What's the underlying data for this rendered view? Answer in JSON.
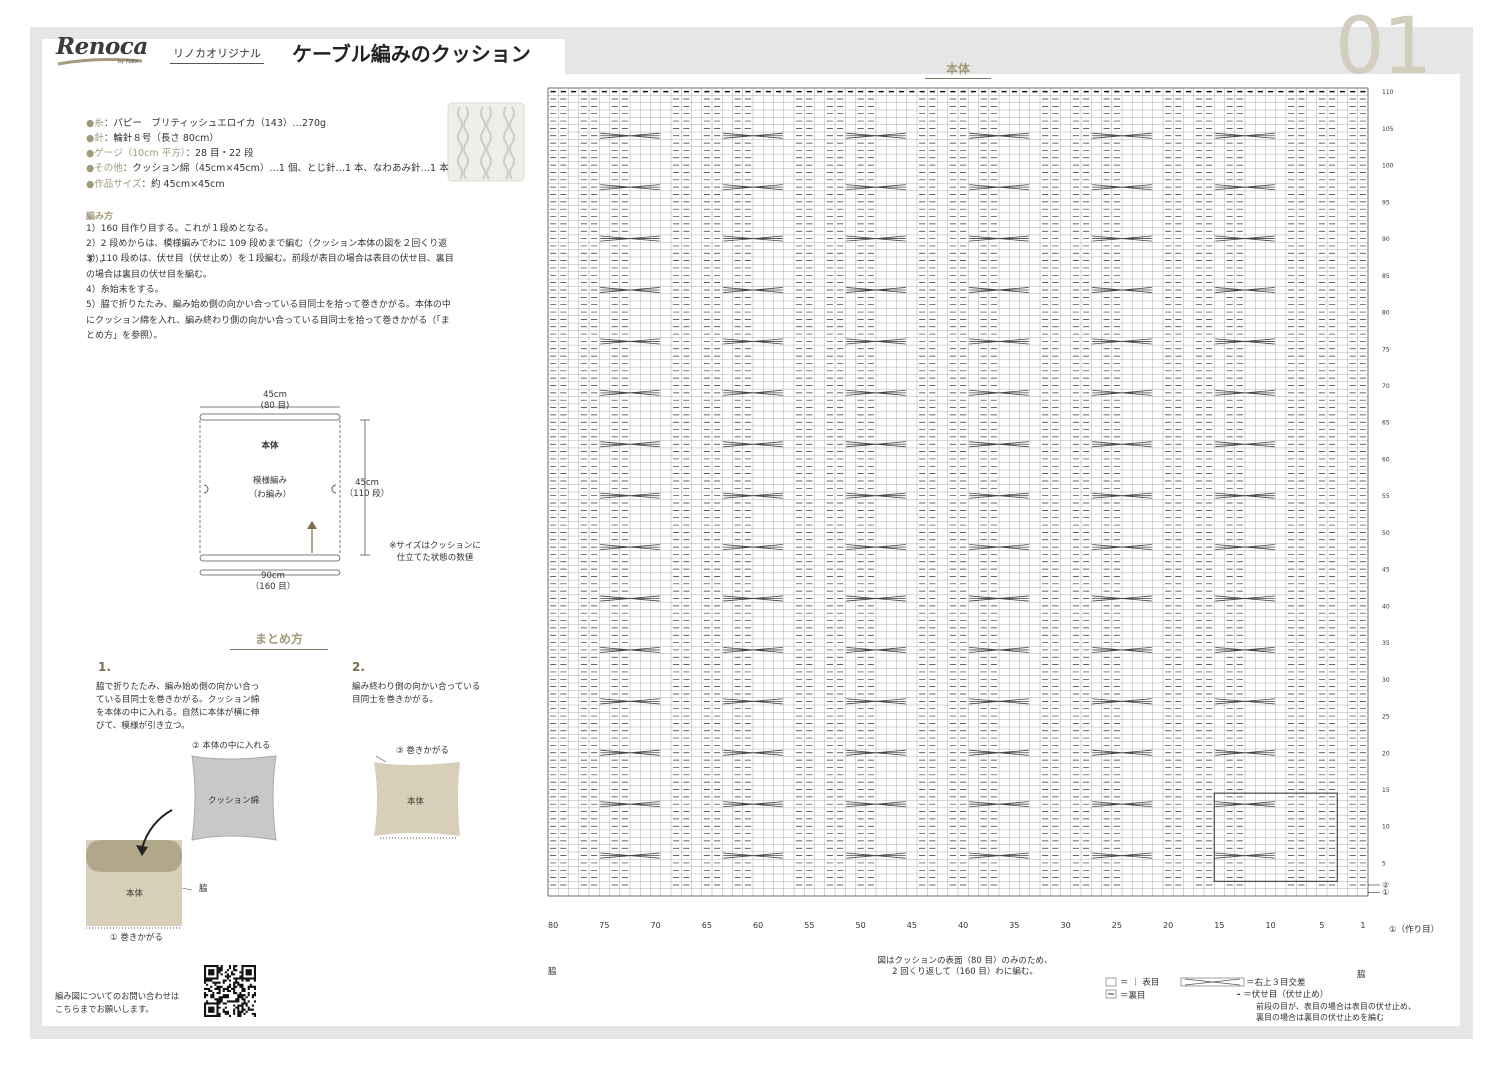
{
  "header": {
    "logo": "Renoca",
    "logo_sub": "by FLEX",
    "subtitle": "リノカオリジナル",
    "title": "ケーブル編みのクッション",
    "page_number": "01"
  },
  "materials": [
    {
      "label": "糸",
      "text": "：パピー　ブリティッシュエロイカ（143）…270g"
    },
    {
      "label": "針",
      "text": "：輪針８号（長さ 80cm）"
    },
    {
      "label": "ゲージ（10cm 平方）",
      "text": "：28 目・22 段"
    },
    {
      "label": "その他",
      "text": "：クッション綿（45cm×45cm）…1 個、とじ針…1 本、なわあみ針…1 本"
    },
    {
      "label": "作品サイズ",
      "text": "：約 45cm×45cm"
    }
  ],
  "instructions": {
    "heading": "編み方",
    "steps": [
      "1）160 目作り目する。これが１段めとなる。",
      "2）2 段めからは、模様編みでわに 109 段めまで編む（クッション本体の図を２回くり返す）。",
      "3）110 段めは、伏せ目（伏せ止め）を１段編む。前段が表目の場合は表目の伏せ目、裏目の場合は裏目の伏せ目を編む。",
      "4）糸始末をする。",
      "5）脇で折りたたみ、編み始め側の向かい合っている目同士を拾って巻きかがる。本体の中にクッション綿を入れ、編み終わり側の向かい合っている目同士を拾って巻きかがる（「まとめ方」を参照）。"
    ]
  },
  "schematic": {
    "width_top": "45cm",
    "width_top_sts": "(80 目)",
    "body_label": "本体",
    "pattern_label": "模様編み",
    "pattern_sub": "（わ編み）",
    "height": "45cm",
    "height_rows": "（110 段）",
    "width_bottom": "90cm",
    "width_bottom_sts": "（160 目）",
    "note_line1": "※サイズはクッションに",
    "note_line2": "仕立てた状態の数値"
  },
  "finishing": {
    "title": "まとめ方",
    "step1_num": "1.",
    "step1_text": [
      "脇で折りたたみ、編み始め側の向かい合っ",
      "ている目同士を巻きかがる。クッション綿",
      "を本体の中に入れる。自然に本体が横に伸",
      "びて、模様が引き立つ。"
    ],
    "step1_fill_label": "② 本体の中に入れる",
    "step1_cushion_label": "クッション綿",
    "step1_body_label": "本体",
    "step1_side_label": "脇",
    "step1_whip_label": "① 巻きかがる",
    "step2_num": "2.",
    "step2_text": [
      "編み終わり側の向かい合っている",
      "目同士を巻きかがる。"
    ],
    "step2_whip_label": "③ 巻きかがる",
    "step2_body_label": "本体"
  },
  "contact": {
    "line1": "編み図についてのお問い合わせは",
    "line2": "こちらまでお願いします。"
  },
  "chart": {
    "title": "本体",
    "stitches": 80,
    "rows": 110,
    "column_labels": [
      "80",
      "75",
      "70",
      "65",
      "60",
      "55",
      "50",
      "45",
      "40",
      "35",
      "30",
      "25",
      "20",
      "15",
      "10",
      "5",
      "1"
    ],
    "row_labels": [
      "110",
      "105",
      "100",
      "95",
      "90",
      "85",
      "80",
      "75",
      "70",
      "65",
      "60",
      "55",
      "50",
      "45",
      "40",
      "35",
      "30",
      "25",
      "20",
      "15",
      "10",
      "5",
      "2",
      "1"
    ],
    "cast_on_label": "①（作り目）",
    "side_left": "脇",
    "side_right": "脇",
    "repeat_note_line1": "図はクッションの表面（80 目）のみのため、",
    "repeat_note_line2": "2 回くり返して（160 目）わに編む。",
    "legend": {
      "knit": "＝ ｜ 表目",
      "purl": "＝裏目",
      "cable": "＝右上３目交差",
      "bindoff": "＝伏せ目（伏せ止め）",
      "bindoff_note1": "前段の目が、表目の場合は表目の伏せ止め、",
      "bindoff_note2": "裏目の場合は裏目の伏せ止めを編む"
    }
  },
  "colors": {
    "frame": "#e6e6e6",
    "accent": "#a39a7c",
    "beige_fill": "#d8cfb8",
    "gray_fill": "#c8c8c8"
  }
}
